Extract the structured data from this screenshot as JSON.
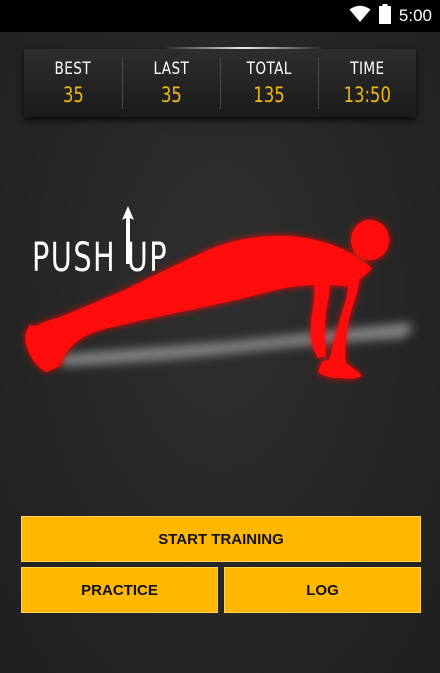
{
  "status_bar": {
    "time": "5:00",
    "icons": [
      "wifi-icon",
      "battery-icon"
    ]
  },
  "stats": [
    {
      "label": "BEST",
      "value": "35"
    },
    {
      "label": "LAST",
      "value": "35"
    },
    {
      "label": "TOTAL",
      "value": "135"
    },
    {
      "label": "TIME",
      "value": "13:50"
    }
  ],
  "hero": {
    "title": "PUSH UP"
  },
  "buttons": {
    "start_training": "START TRAINING",
    "practice": "PRACTICE",
    "log": "LOG"
  },
  "colors": {
    "accent": "#ffb700",
    "stat_value": "#f0b90b",
    "figure": "#ff1111"
  }
}
